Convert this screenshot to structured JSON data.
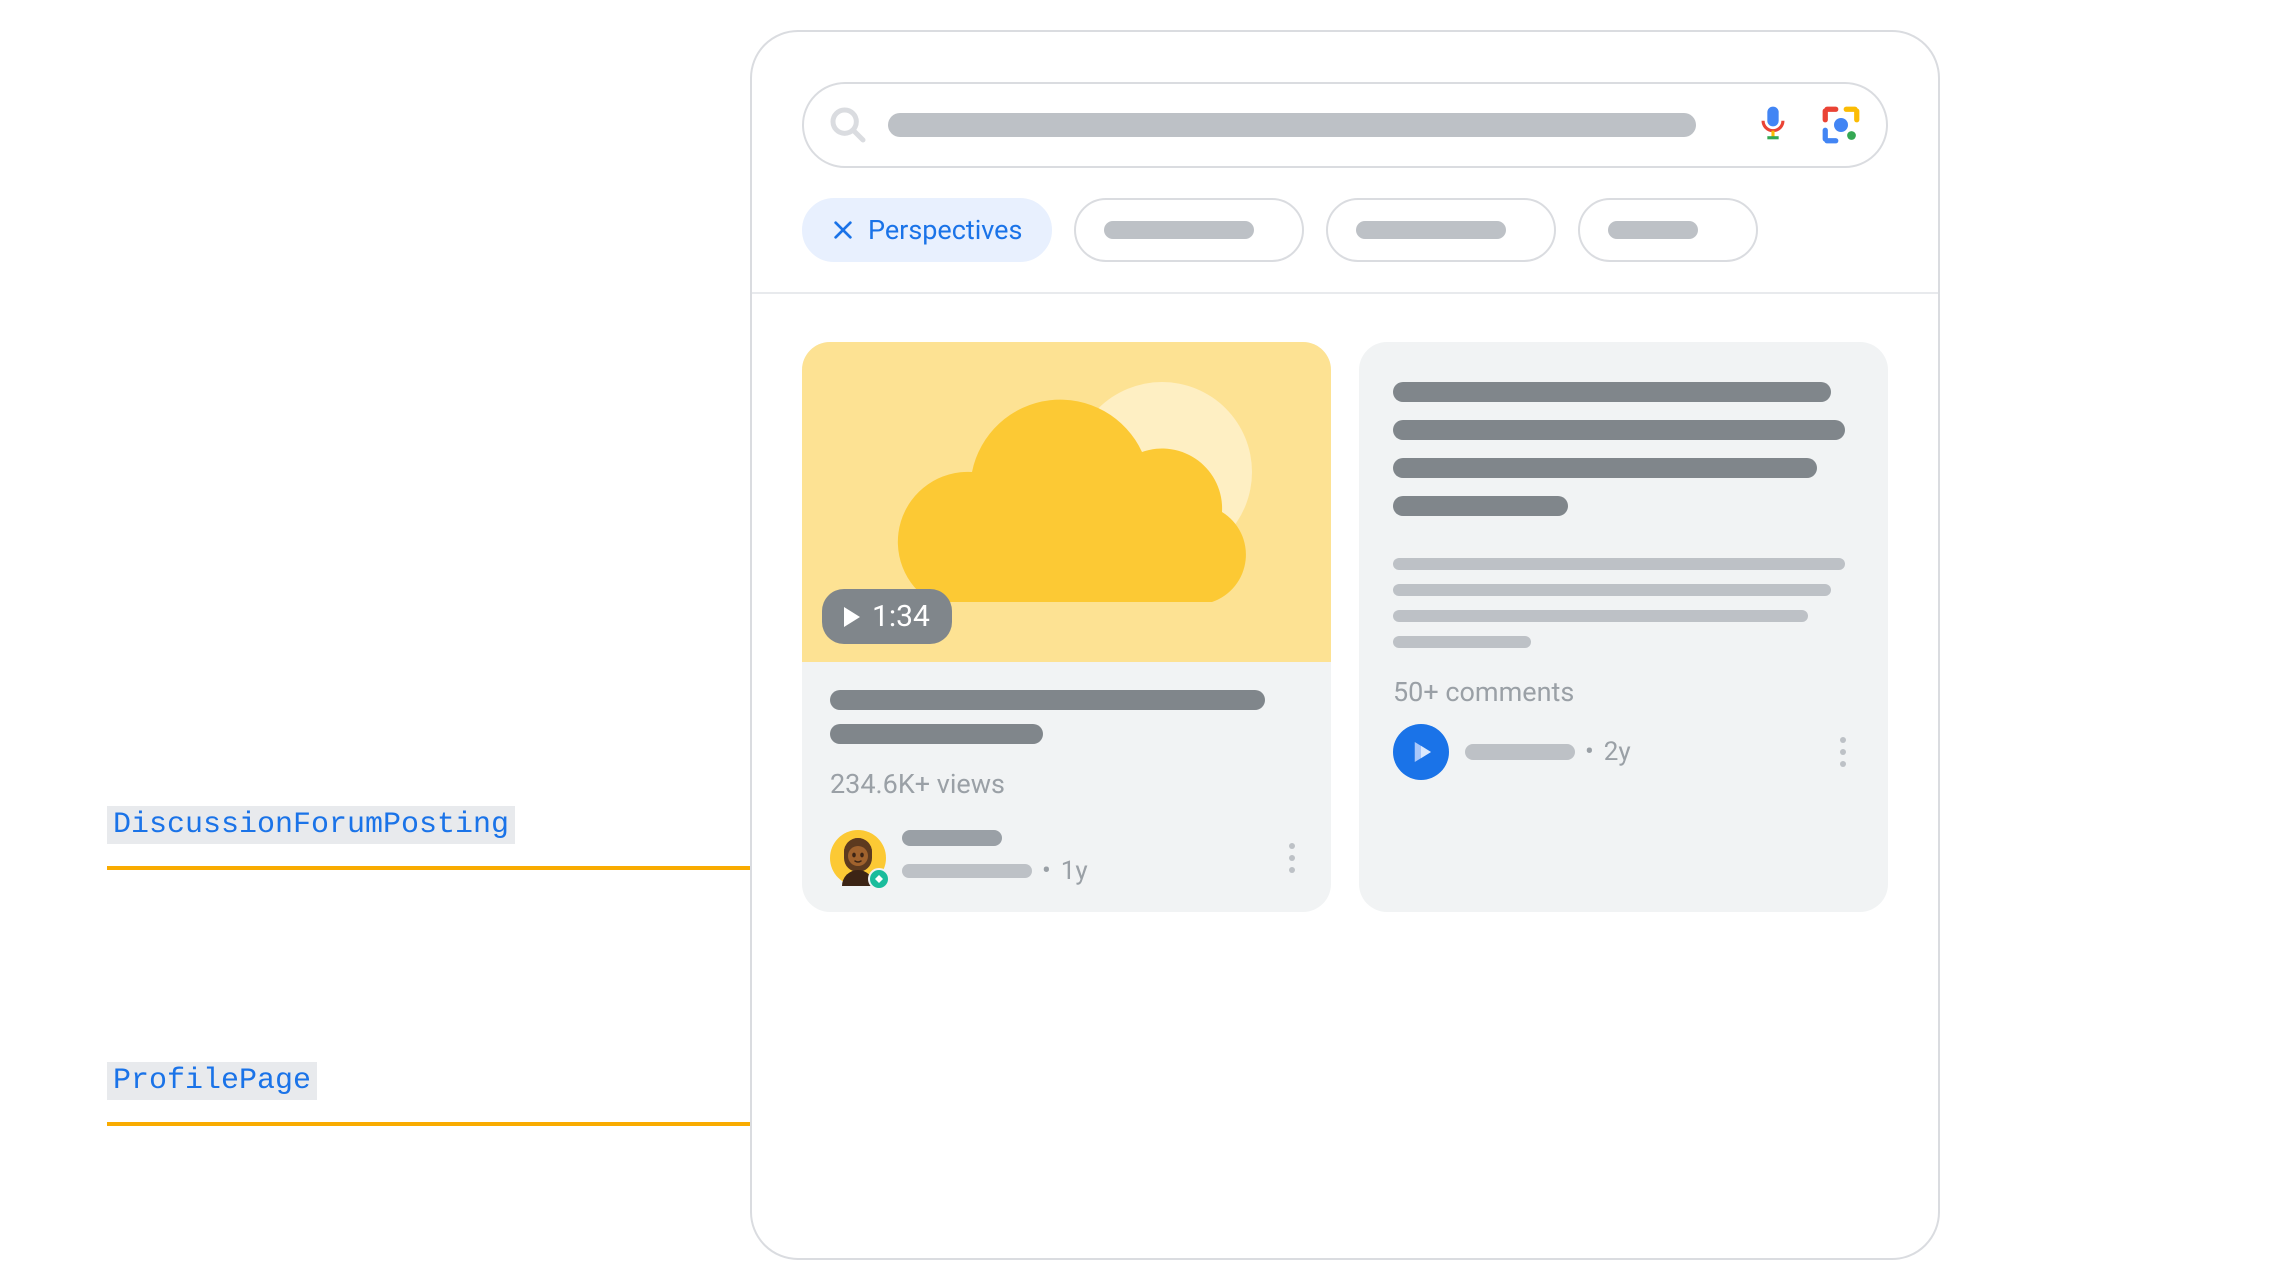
{
  "annotations": {
    "discussion": "DiscussionForumPosting",
    "profile": "ProfilePage"
  },
  "chips": {
    "active_label": "Perspectives"
  },
  "card1": {
    "duration": "1:34",
    "views": "234.6K+ views",
    "age": "1y"
  },
  "card2": {
    "comments": "50+ comments",
    "age": "2y"
  }
}
